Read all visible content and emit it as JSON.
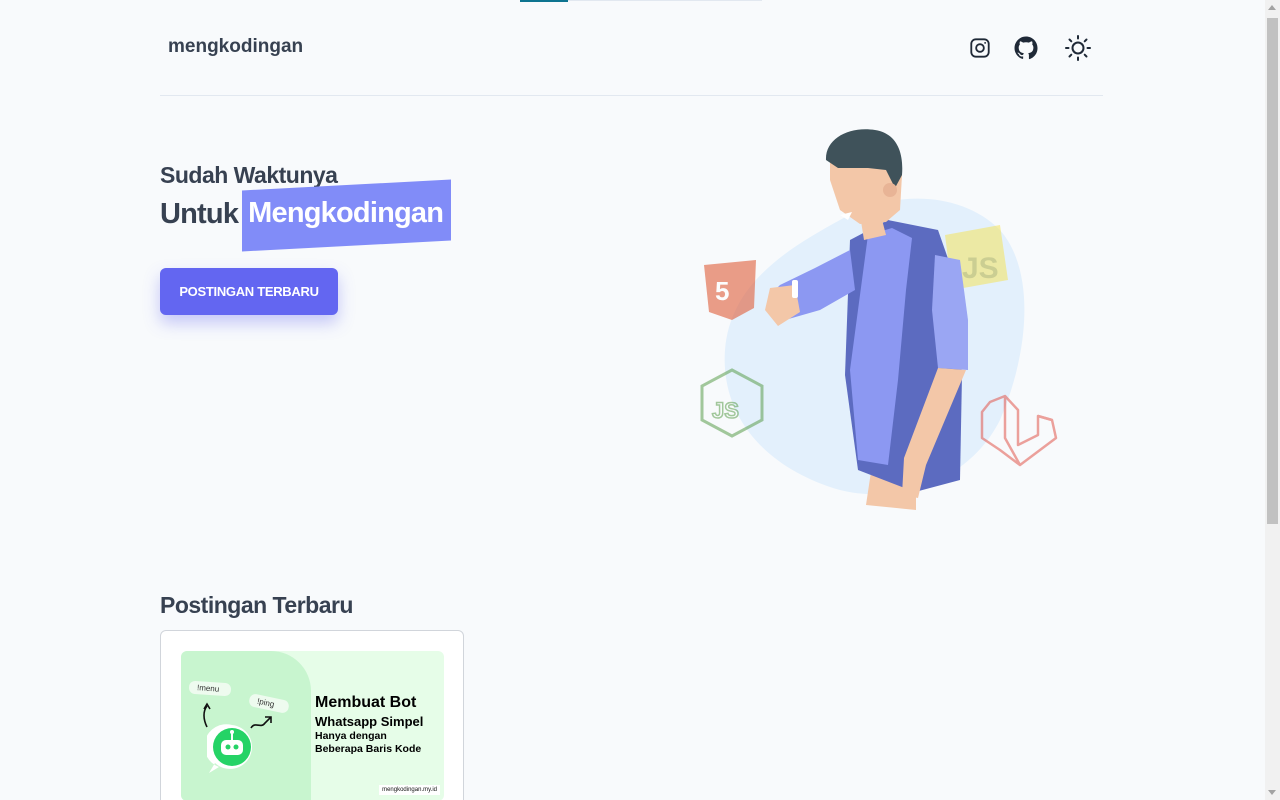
{
  "header": {
    "brand": "mengkodingan",
    "icons": [
      "instagram-icon",
      "github-icon",
      "sun-icon"
    ]
  },
  "hero": {
    "line1": "Sudah Waktunya",
    "line2_prefix": "Untuk",
    "line2_highlight": "Mengkodingan",
    "cta_label": "POSTINGAN TERBARU"
  },
  "illustration": {
    "badges": [
      "html5-icon",
      "javascript-icon",
      "nodejs-icon",
      "laravel-icon"
    ]
  },
  "latest": {
    "title": "Postingan Terbaru",
    "posts": [
      {
        "thumb_title_1": "Membuat Bot",
        "thumb_title_2": "Whatsapp Simpel",
        "thumb_title_3": "Hanya dengan",
        "thumb_title_4": "Beberapa Baris Kode",
        "thumb_domain": "mengkodingan.my.id",
        "pill_1": "!menu",
        "pill_2": "!ping"
      }
    ]
  },
  "colors": {
    "accent": "#6366f1",
    "highlight": "#818cf8",
    "background": "#f8fafc",
    "text": "#374151"
  }
}
